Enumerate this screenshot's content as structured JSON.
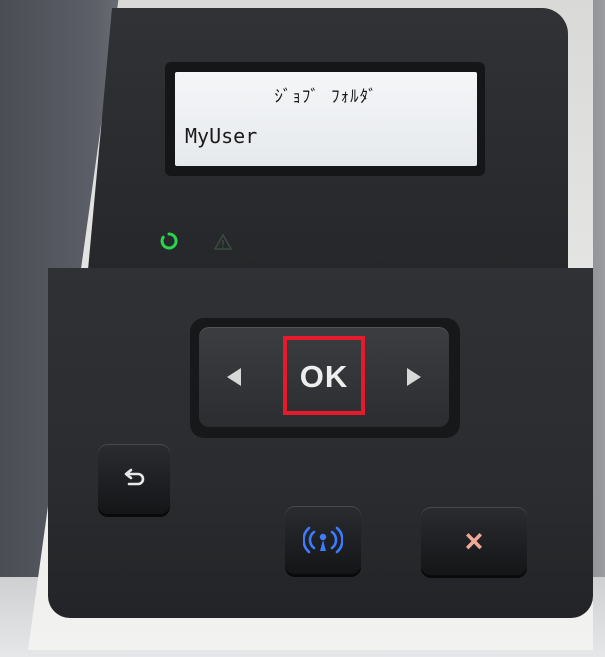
{
  "lcd": {
    "line1": "ｼﾞｮﾌﾞ ﾌｫﾙﾀﾞ",
    "line2": "MyUser"
  },
  "indicators": {
    "ready_icon": "ready-power-icon",
    "attention_icon": "attention-warning-icon",
    "ready_color": "#29d44a",
    "attention_color": "#3a4a3e"
  },
  "controls": {
    "left_arrow_icon": "left-arrow-icon",
    "right_arrow_icon": "right-arrow-icon",
    "ok_label": "OK",
    "back_icon": "back-arrow-icon",
    "wireless_icon": "wireless-icon",
    "wireless_color": "#3d7bff",
    "cancel_label": "×",
    "cancel_color": "#f0a996"
  },
  "highlight": {
    "target": "ok",
    "color": "#e51a2a"
  }
}
